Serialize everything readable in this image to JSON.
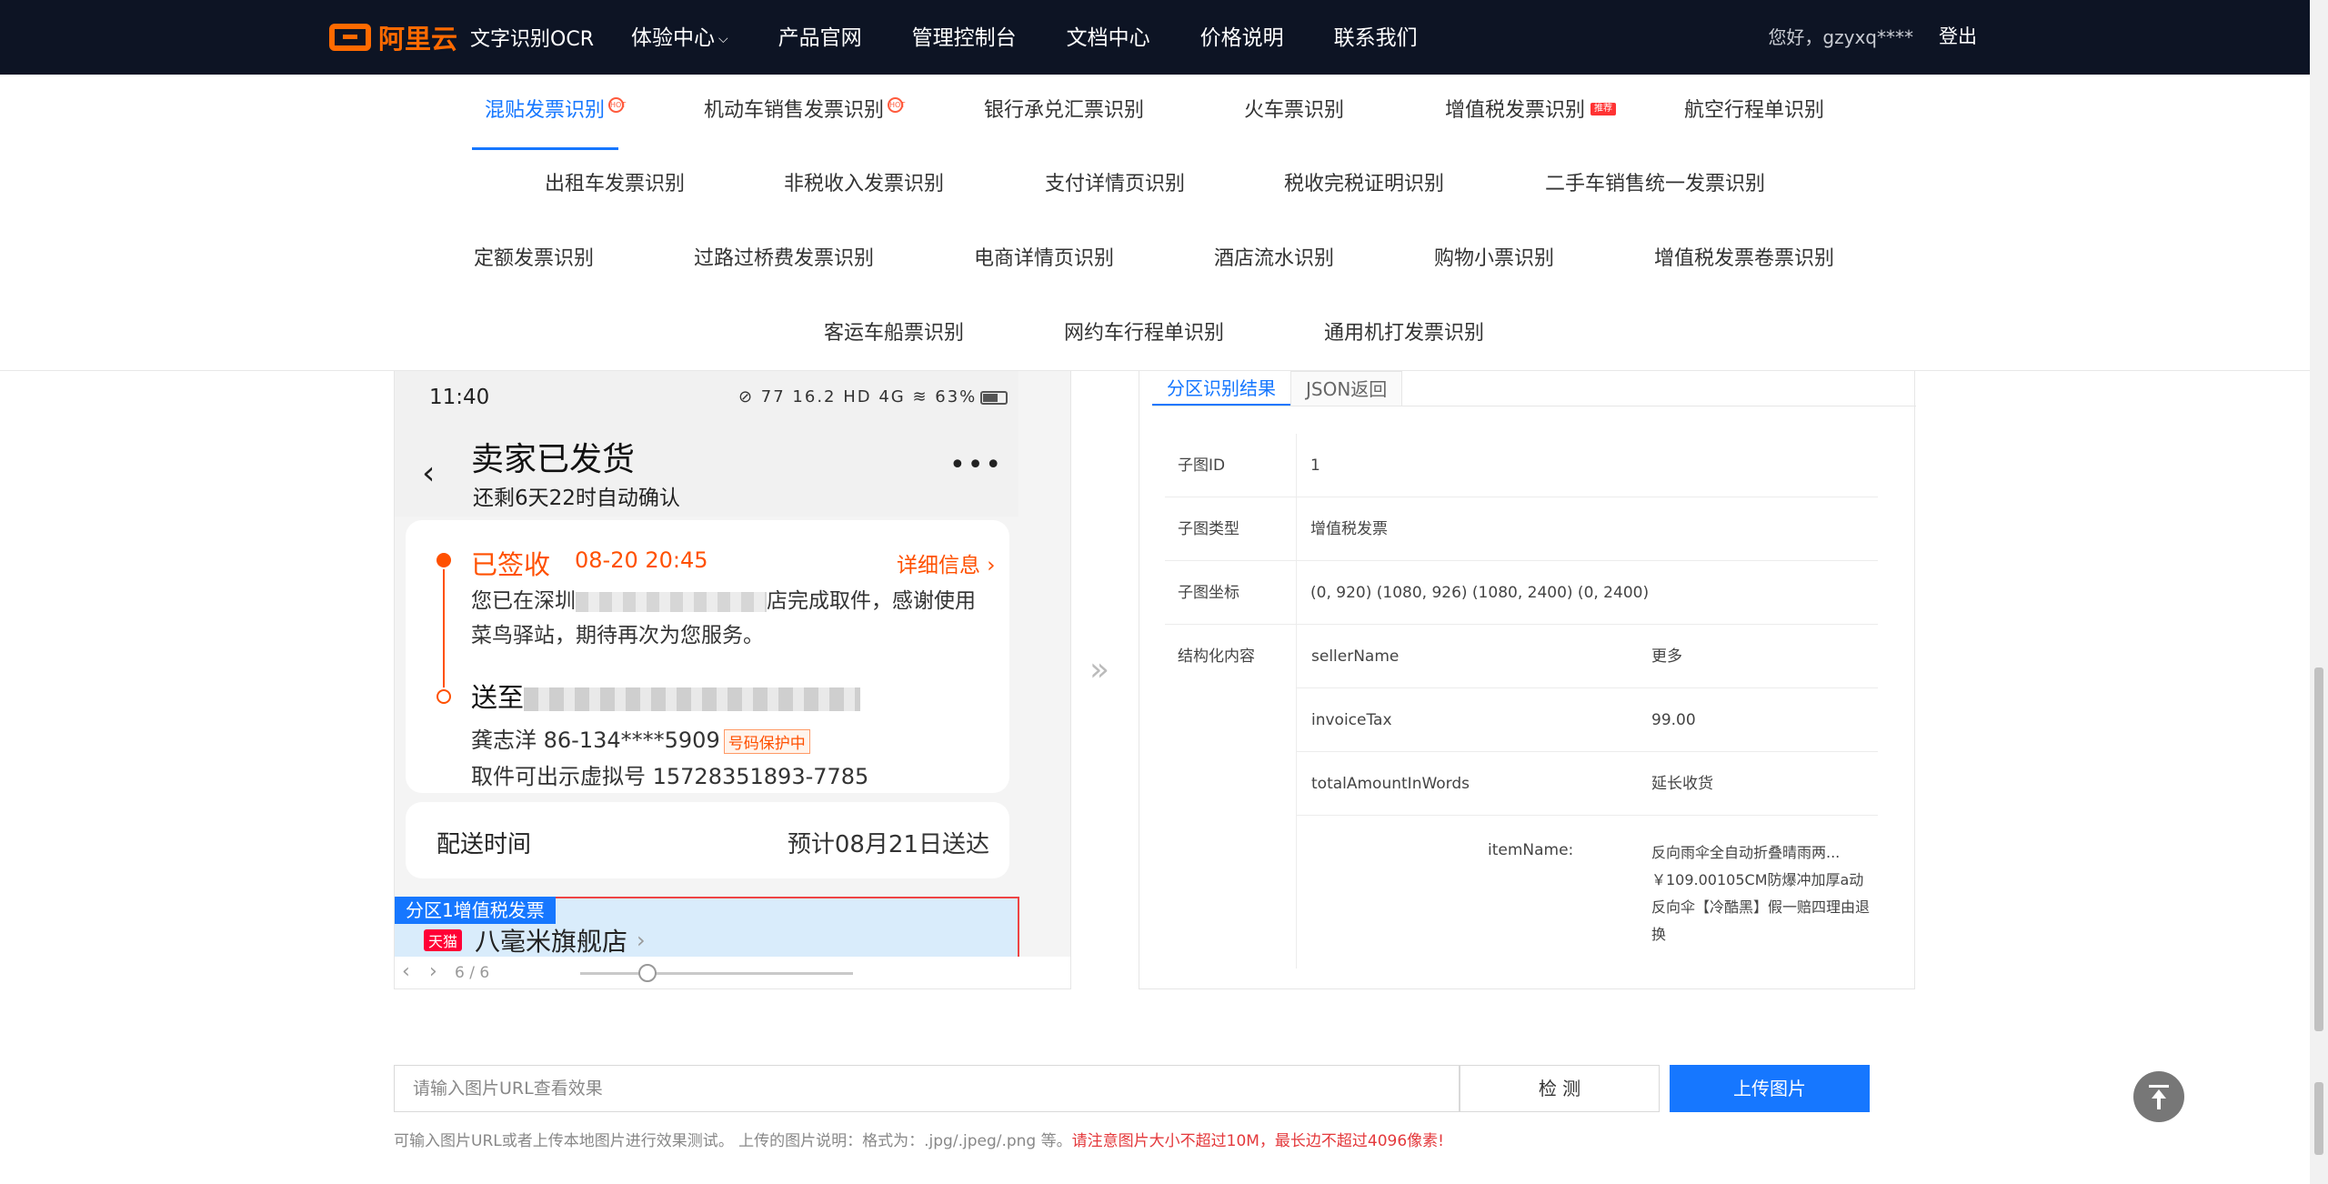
{
  "header": {
    "brand": "阿里云",
    "product": "文字识别OCR",
    "nav": [
      "体验中心",
      "产品官网",
      "管理控制台",
      "文档中心",
      "价格说明",
      "联系我们"
    ],
    "greeting": "您好，gzyxq****",
    "logout": "登出"
  },
  "tabs": {
    "row1": [
      "混贴发票识别",
      "机动车销售发票识别",
      "银行承兑汇票识别",
      "火车票识别",
      "增值税发票识别",
      "航空行程单识别"
    ],
    "row2": [
      "出租车发票识别",
      "非税收入发票识别",
      "支付详情页识别",
      "税收完税证明识别",
      "二手车销售统一发票识别"
    ],
    "row3": [
      "定额发票识别",
      "过路过桥费发票识别",
      "电商详情页识别",
      "酒店流水识别",
      "购物小票识别",
      "增值税发票卷票识别"
    ],
    "row4": [
      "客运车船票识别",
      "网约车行程单识别",
      "通用机打发票识别"
    ],
    "hot_badge": "HOT",
    "rec_badge": "推荐"
  },
  "preview": {
    "status_time": "11:40",
    "status_icons": "⊘ 77 16.2 HD 4G ≋ 63%",
    "title": "卖家已发货",
    "subtitle": "还剩6天22时自动确认",
    "sign_status": "已签收",
    "sign_time": "08-20 20:45",
    "detail_link": "详细信息 ›",
    "msg_pre": "您已在深圳",
    "msg_post": "店完成取件，感谢使用菜鸟驿站，期待再次为您服务。",
    "send_to": "送至",
    "receiver": "龚志洋 86-134****5909",
    "protect_tag": "号码保护中",
    "virtual_no": "取件可出示虚拟号 15728351893-7785",
    "ship_label": "配送时间",
    "ship_eta": "预计08月21日送达",
    "region_label": "分区1增值税发票",
    "tmall": "天猫",
    "shop_name": "八毫米旗舰店",
    "page": "6 / 6"
  },
  "result": {
    "tab_active": "分区识别结果",
    "tab_json": "JSON返回",
    "rows": [
      {
        "key": "子图ID",
        "value": "1"
      },
      {
        "key": "子图类型",
        "value": "增值税发票"
      },
      {
        "key": "子图坐标",
        "value": "(0, 920) (1080, 926) (1080, 2400) (0, 2400)"
      }
    ],
    "structured_key": "结构化内容",
    "structured": [
      {
        "key": "sellerName",
        "value": "更多"
      },
      {
        "key": "invoiceTax",
        "value": "99.00"
      },
      {
        "key": "totalAmountInWords",
        "value": "延长收货"
      }
    ],
    "item_key": "itemName:",
    "item_value": "反向雨伞全自动折叠晴雨两...￥109.00105CM防爆冲加厚a动反向伞【冷酷黑】假一赔四理由退换"
  },
  "footer": {
    "url_placeholder": "请输入图片URL查看效果",
    "detect": "检 测",
    "upload": "上传图片",
    "hint": "可输入图片URL或者上传本地图片进行效果测试。 上传的图片说明：格式为：.jpg/.jpeg/.png 等。",
    "hint_warn": "请注意图片大小不超过10M，最长边不超过4096像素!"
  }
}
